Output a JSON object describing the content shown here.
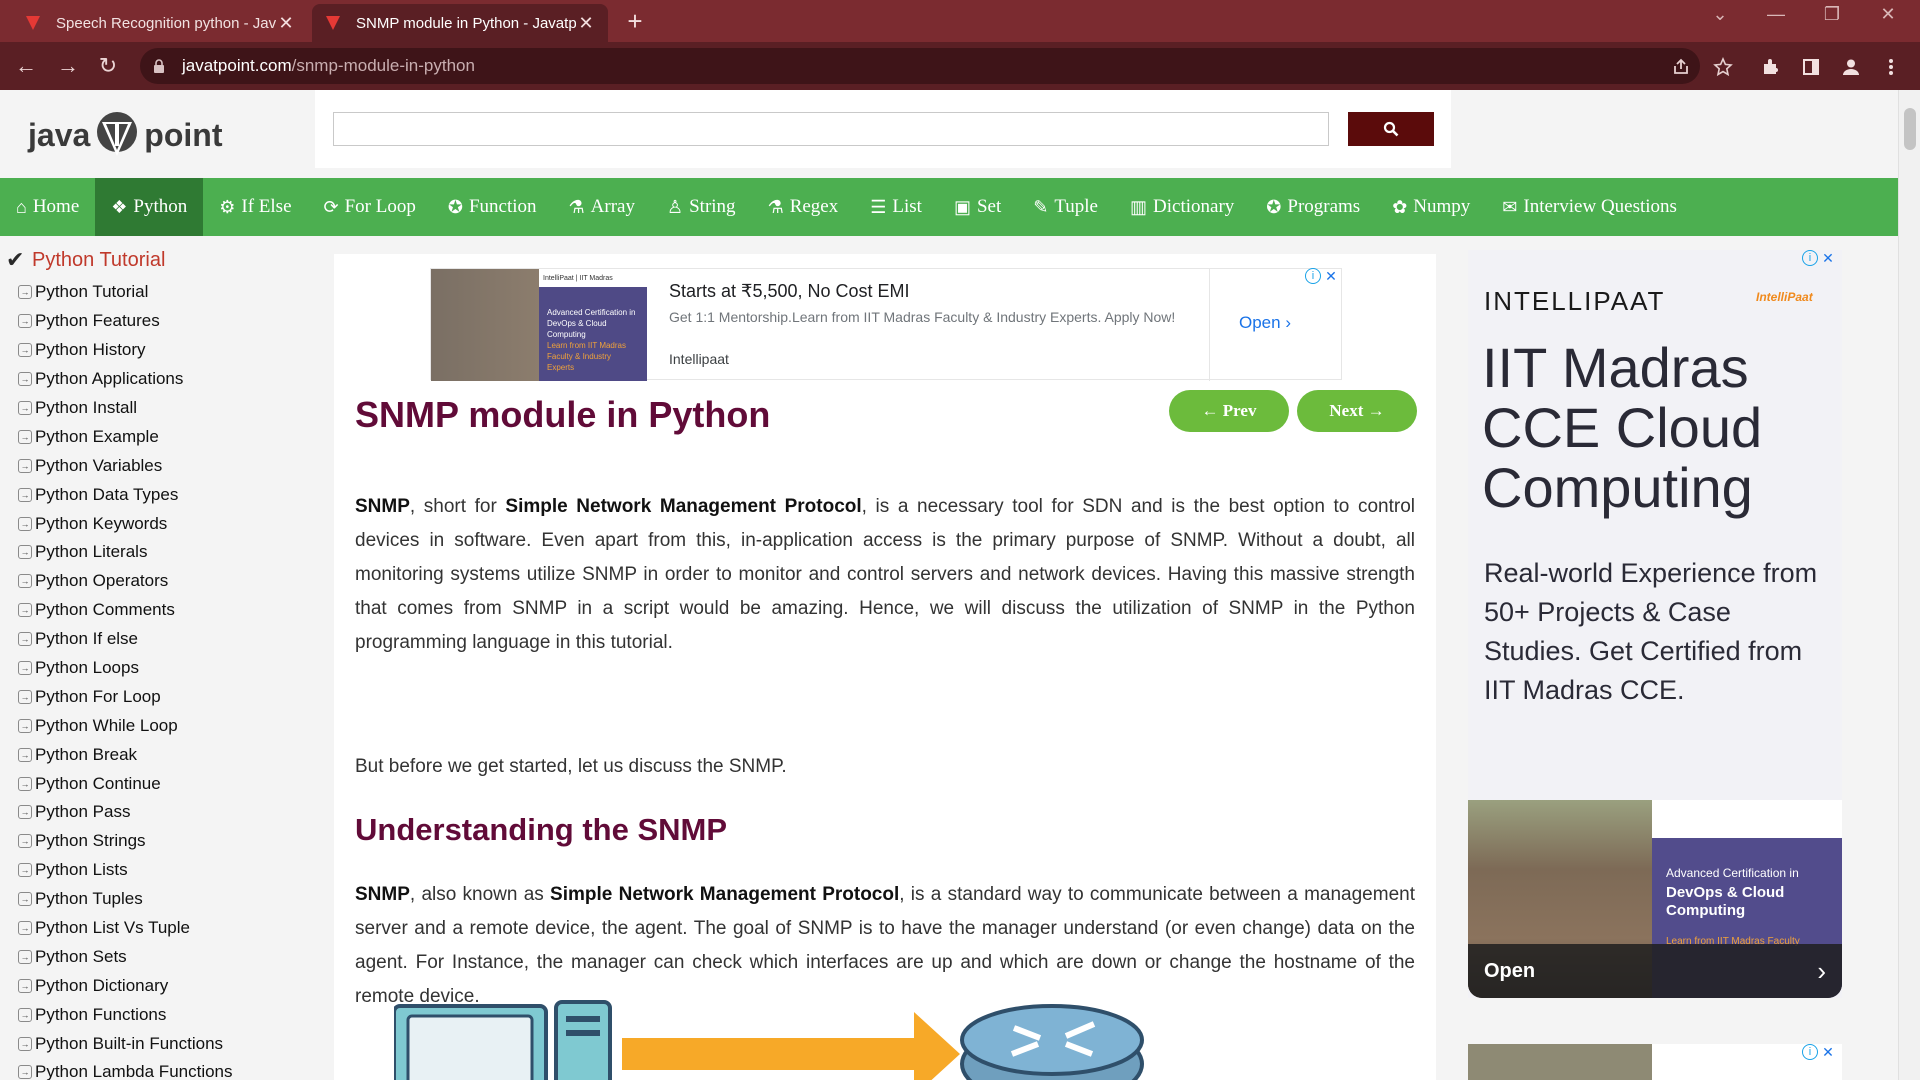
{
  "browser": {
    "tabs": [
      {
        "title": "Speech Recognition python - Jav",
        "active": false
      },
      {
        "title": "SNMP module in Python - Javatp",
        "active": true
      }
    ],
    "url_domain": "javatpoint.com",
    "url_path": "/snmp-module-in-python",
    "accent_color": "#7b2b30"
  },
  "site": {
    "logo_left": "java",
    "logo_right": "point",
    "search_placeholder": ""
  },
  "menu": [
    {
      "icon": "home-icon",
      "glyph": "⌂",
      "label": "Home"
    },
    {
      "icon": "python-icon",
      "glyph": "❖",
      "label": "Python",
      "active": true
    },
    {
      "icon": "ifelse-icon",
      "glyph": "⚙",
      "label": "If Else"
    },
    {
      "icon": "loop-icon",
      "glyph": "⟳",
      "label": "For Loop"
    },
    {
      "icon": "function-icon",
      "glyph": "✪",
      "label": "Function"
    },
    {
      "icon": "array-icon",
      "glyph": "⚗",
      "label": "Array"
    },
    {
      "icon": "string-icon",
      "glyph": "♙",
      "label": "String"
    },
    {
      "icon": "regex-icon",
      "glyph": "⚗",
      "label": "Regex"
    },
    {
      "icon": "list-icon",
      "glyph": "☰",
      "label": "List"
    },
    {
      "icon": "set-icon",
      "glyph": "▣",
      "label": "Set"
    },
    {
      "icon": "tuple-icon",
      "glyph": "✎",
      "label": "Tuple"
    },
    {
      "icon": "dictionary-icon",
      "glyph": "▥",
      "label": "Dictionary"
    },
    {
      "icon": "programs-icon",
      "glyph": "✪",
      "label": "Programs"
    },
    {
      "icon": "numpy-icon",
      "glyph": "✿",
      "label": "Numpy"
    },
    {
      "icon": "interview-icon",
      "glyph": "✉",
      "label": "Interview Questions"
    }
  ],
  "sidebar": {
    "heading": "Python Tutorial",
    "items": [
      "Python Tutorial",
      "Python Features",
      "Python History",
      "Python Applications",
      "Python Install",
      "Python Example",
      "Python Variables",
      "Python Data Types",
      "Python Keywords",
      "Python Literals",
      "Python Operators",
      "Python Comments",
      "Python If else",
      "Python Loops",
      "Python For Loop",
      "Python While Loop",
      "Python Break",
      "Python Continue",
      "Python Pass",
      "Python Strings",
      "Python Lists",
      "Python Tuples",
      "Python List Vs Tuple",
      "Python Sets",
      "Python Dictionary",
      "Python Functions",
      "Python Built-in Functions",
      "Python Lambda Functions"
    ]
  },
  "ad_top": {
    "headline": "Starts at ₹5,500, No Cost EMI",
    "description": "Get 1:1 Mentorship.Learn from IIT Madras Faculty & Industry Experts. Apply Now!",
    "brand": "Intellipaat",
    "open": "Open",
    "thumb_title": "Advanced Certification in DevOps & Cloud Computing",
    "thumb_sub": "Learn from IIT Madras Faculty & Industry Experts"
  },
  "article": {
    "prev": "← Prev",
    "next": "Next →",
    "title": "SNMP module in Python",
    "p1_b1": "SNMP",
    "p1_t1": ", short for ",
    "p1_b2": "Simple Network Management Protocol",
    "p1_t2": ", is a necessary tool for SDN and is the best option to control devices in software. Even apart from this, in-application access is the primary purpose of SNMP. Without a doubt, all monitoring systems utilize SNMP in order to monitor and control servers and network devices. Having this massive strength that comes from SNMP in a script would be amazing. Hence, we will discuss the utilization of SNMP in the Python programming language in this tutorial.",
    "p2": "But before we get started, let us discuss the SNMP.",
    "h2": "Understanding the SNMP",
    "p3_b1": "SNMP",
    "p3_t1": ", also known as ",
    "p3_b2": "Simple Network Management Protocol",
    "p3_t2": ", is a standard way to communicate between a management server and a remote device, the agent. The goal of SNMP is to have the manager understand (or even change) data on the agent. For Instance, the manager can check which interfaces are up and which are down or change the hostname of the remote device."
  },
  "ad_right": {
    "brand": "INTELLIPAAT",
    "logo": "IntelliPaat",
    "headline": "IIT Madras CCE Cloud Computing",
    "subtext": "Real-world Experience from 50+ Projects & Case Studies. Get Certified from IIT Madras CCE.",
    "img_line1": "Advanced Certification in",
    "img_line2": "DevOps & Cloud Computing",
    "img_line3": "Learn from IIT Madras Faculty",
    "open": "Open"
  }
}
